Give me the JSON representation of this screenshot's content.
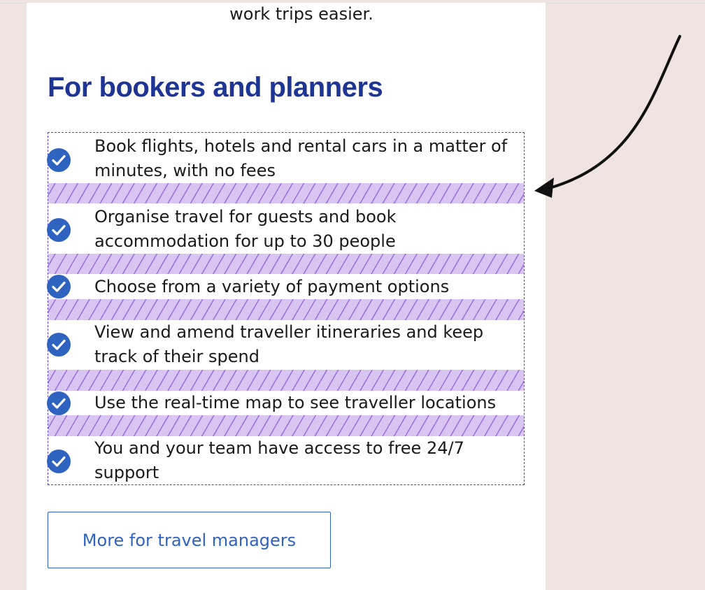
{
  "intro": {
    "tail_text": "work trips easier."
  },
  "section": {
    "heading": "For bookers and planners",
    "items": [
      {
        "text": "Book flights, hotels and rental cars in a matter of minutes, with no fees",
        "icon": "check-circle-icon"
      },
      {
        "text": "Organise travel for guests and book accommodation for up to 30 people",
        "icon": "check-circle-icon"
      },
      {
        "text": "Choose from a variety of payment options",
        "icon": "check-circle-icon"
      },
      {
        "text": "View and amend traveller itineraries and keep track of their spend",
        "icon": "check-circle-icon"
      },
      {
        "text": "Use the real-time map to see traveller locations",
        "icon": "check-circle-icon"
      },
      {
        "text": "You and your team have access to free 24/7 support",
        "icon": "check-circle-icon"
      }
    ],
    "cta_label": "More for travel managers"
  },
  "colors": {
    "heading": "#1e3596",
    "accent": "#2f63c0",
    "gap_highlight": "#d9c5f2",
    "outline": "#5b3bd6",
    "page_bg": "#efe4e2"
  }
}
